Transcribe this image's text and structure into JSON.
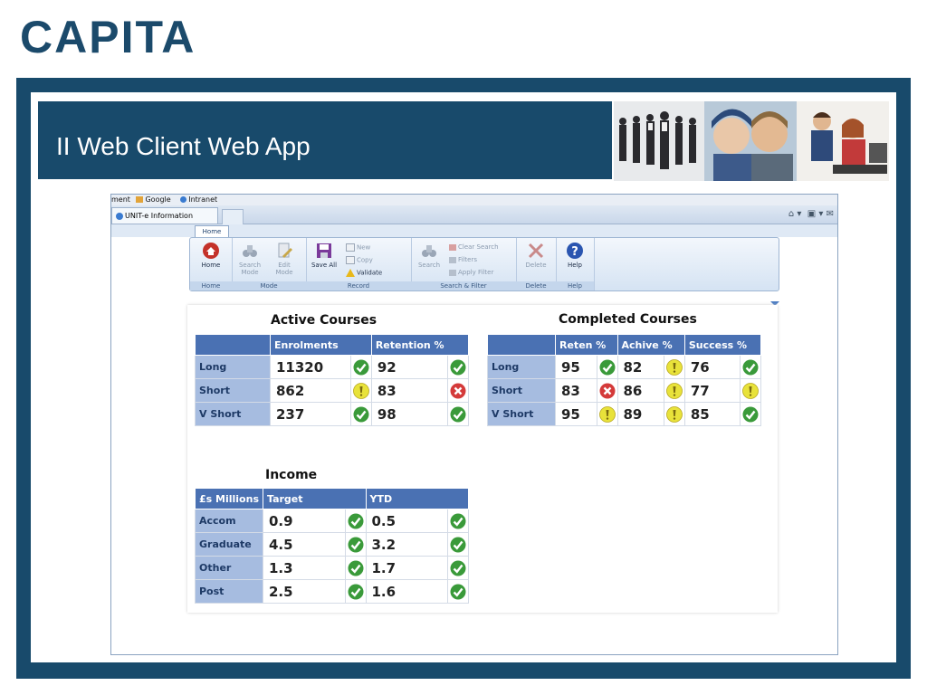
{
  "brand": {
    "logo_text": "CAPITA"
  },
  "slide": {
    "title": "II Web Client Web App"
  },
  "browser": {
    "links_bar": [
      "ment",
      "Google",
      "Intranet"
    ],
    "tab_title": "UNIT-e Information Int...",
    "tab_close": "×"
  },
  "ribbon": {
    "tab": "Home",
    "groups": {
      "home": {
        "label": "Home",
        "buttons": {
          "home": "Home"
        }
      },
      "mode": {
        "label": "Mode",
        "buttons": {
          "search_mode": "Search Mode",
          "edit_mode": "Edit Mode"
        }
      },
      "record": {
        "label": "Record",
        "buttons": {
          "save_all": "Save All",
          "new": "New",
          "copy": "Copy",
          "validate": "Validate"
        }
      },
      "search_filter": {
        "label": "Search & Filter",
        "buttons": {
          "search": "Search",
          "clear_search": "Clear Search",
          "filters": "Filters",
          "apply_filter": "Apply Filter"
        }
      },
      "delete": {
        "label": "Delete",
        "buttons": {
          "delete": "Delete"
        }
      },
      "help": {
        "label": "Help",
        "buttons": {
          "help": "Help"
        }
      }
    }
  },
  "colors": {
    "frame": "#184a6b",
    "table_header": "#4a71b3",
    "row_header": "#a6bce0",
    "ok": "#3a9a3a",
    "warn": "#e8e23a",
    "bad": "#d43a3a"
  },
  "active_courses": {
    "title": "Active Courses",
    "headers": [
      "",
      "Enrolments",
      "Retention %"
    ],
    "rows": [
      {
        "label": "Long",
        "enrol": "11320",
        "enrol_status": "ok",
        "ret": "92",
        "ret_status": "ok"
      },
      {
        "label": "Short",
        "enrol": "862",
        "enrol_status": "warn",
        "ret": "83",
        "ret_status": "bad"
      },
      {
        "label": "V Short",
        "enrol": "237",
        "enrol_status": "ok",
        "ret": "98",
        "ret_status": "ok"
      }
    ]
  },
  "completed_courses": {
    "title": "Completed Courses",
    "headers": [
      "",
      "Reten %",
      "Achive %",
      "Success %"
    ],
    "rows": [
      {
        "label": "Long",
        "reten": "95",
        "reten_status": "ok",
        "achive": "82",
        "achive_status": "warn",
        "success": "76",
        "success_status": "ok"
      },
      {
        "label": "Short",
        "reten": "83",
        "reten_status": "bad",
        "achive": "86",
        "achive_status": "warn",
        "success": "77",
        "success_status": "warn"
      },
      {
        "label": "V Short",
        "reten": "95",
        "reten_status": "warn",
        "achive": "89",
        "achive_status": "warn",
        "success": "85",
        "success_status": "ok"
      }
    ]
  },
  "income": {
    "title": "Income",
    "headers": [
      "£s Millions",
      "Target",
      "YTD"
    ],
    "rows": [
      {
        "label": "Accom",
        "target": "0.9",
        "target_status": "ok",
        "ytd": "0.5",
        "ytd_status": "ok"
      },
      {
        "label": "Graduate",
        "target": "4.5",
        "target_status": "ok",
        "ytd": "3.2",
        "ytd_status": "ok"
      },
      {
        "label": "Other",
        "target": "1.3",
        "target_status": "ok",
        "ytd": "1.7",
        "ytd_status": "ok"
      },
      {
        "label": "Post",
        "target": "2.5",
        "target_status": "ok",
        "ytd": "1.6",
        "ytd_status": "ok"
      }
    ]
  }
}
